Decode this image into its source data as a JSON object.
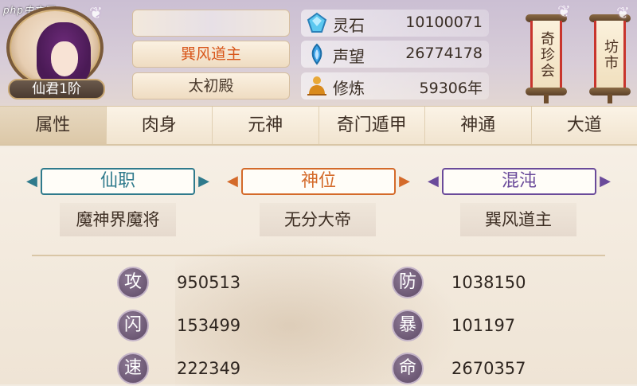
{
  "watermark": "php中文网",
  "player": {
    "rank": "仙君1阶",
    "name_hidden": "",
    "title": "巽风道主",
    "palace": "太初殿"
  },
  "resources": [
    {
      "icon": "spirit-stone-icon",
      "label": "灵石",
      "value": "10100071"
    },
    {
      "icon": "reputation-icon",
      "label": "声望",
      "value": "26774178"
    },
    {
      "icon": "cultivation-icon",
      "label": "修炼",
      "value": "59306年"
    }
  ],
  "scrolls": [
    {
      "label": "奇珍会"
    },
    {
      "label": "坊市"
    }
  ],
  "tabs": [
    {
      "label": "属性",
      "active": true
    },
    {
      "label": "肉身",
      "active": false
    },
    {
      "label": "元神",
      "active": false
    },
    {
      "label": "奇门遁甲",
      "active": false
    },
    {
      "label": "神通",
      "active": false
    },
    {
      "label": "大道",
      "active": false
    }
  ],
  "titles": [
    {
      "heading": "仙职",
      "value": "魔神界魔将",
      "color": "#2f7a8c"
    },
    {
      "heading": "神位",
      "value": "无分大帝",
      "color": "#d46a2a"
    },
    {
      "heading": "混沌",
      "value": "巽风道主",
      "color": "#6a4a9a"
    }
  ],
  "stats": [
    {
      "label": "攻",
      "value": "950513"
    },
    {
      "label": "防",
      "value": "1038150"
    },
    {
      "label": "闪",
      "value": "153499"
    },
    {
      "label": "暴",
      "value": "101197"
    },
    {
      "label": "速",
      "value": "222349"
    },
    {
      "label": "命",
      "value": "2670357"
    }
  ]
}
